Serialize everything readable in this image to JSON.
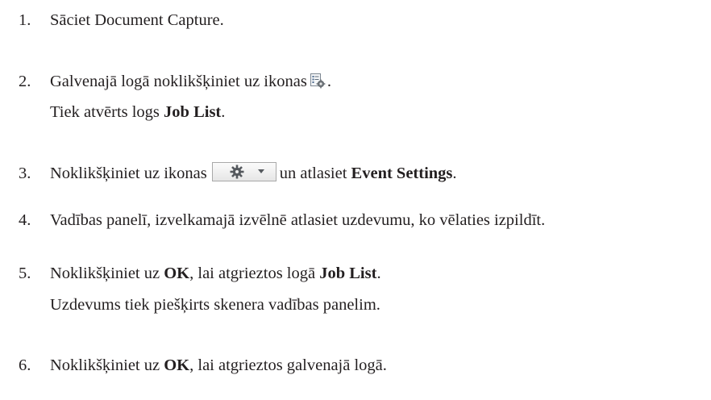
{
  "steps": [
    {
      "num": "1.",
      "lines": [
        {
          "text": "Sāciet Document Capture."
        }
      ]
    },
    {
      "num": "2.",
      "lines": [
        {
          "before": "Galvenajā logā noklikšķiniet uz ikonas",
          "after": "."
        },
        {
          "before": "Tiek atvērts logs ",
          "bold": "Job List",
          "after": "."
        }
      ]
    },
    {
      "num": "3.",
      "lines": [
        {
          "before": "Noklikšķiniet uz ikonas",
          "middle": "un atlasiet ",
          "bold": "Event Settings",
          "after": "."
        }
      ]
    },
    {
      "num": "4.",
      "lines": [
        {
          "text": "Vadības panelī, izvelkamajā izvēlnē atlasiet uzdevumu, ko vēlaties izpildīt."
        }
      ]
    },
    {
      "num": "5.",
      "lines": [
        {
          "before": "Noklikšķiniet uz ",
          "bold": "OK",
          "middle": ", lai atgrieztos logā ",
          "bold2": "Job List",
          "after": "."
        },
        {
          "text": "Uzdevums tiek piešķirts skenera vadības panelim."
        }
      ]
    },
    {
      "num": "6.",
      "lines": [
        {
          "before": "Noklikšķiniet uz ",
          "bold": "OK",
          "after": ", lai atgrieztos galvenajā logā."
        }
      ]
    }
  ],
  "icons": {
    "job_list_icon": "job-list-settings-icon",
    "event_settings_icon": "gear-dropdown-icon"
  }
}
